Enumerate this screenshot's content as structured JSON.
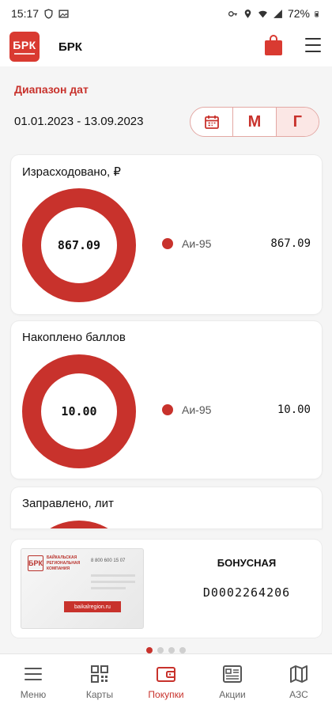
{
  "status_bar": {
    "time": "15:17",
    "battery": "72%"
  },
  "app_bar": {
    "logo_text": "БРК",
    "title": "БРК"
  },
  "date_range": {
    "label": "Диапазон дат",
    "value": "01.01.2023 - 13.09.2023",
    "segments": [
      {
        "label": "",
        "icon": "calendar-icon",
        "active": false
      },
      {
        "label": "М",
        "active": false
      },
      {
        "label": "Г",
        "active": true
      }
    ]
  },
  "cards": [
    {
      "title": "Израсходовано, ₽",
      "total": "867.09",
      "legend": [
        {
          "name": "Аи-95",
          "value": "867.09"
        }
      ]
    },
    {
      "title": "Накоплено баллов",
      "total": "10.00",
      "legend": [
        {
          "name": "Аи-95",
          "value": "10.00"
        }
      ]
    },
    {
      "title": "Заправлено, лит"
    }
  ],
  "bonus_card": {
    "title": "БОНУСНАЯ",
    "number": "D0002264206",
    "image": {
      "logo": "БРК",
      "company": "БАЙКАЛЬСКАЯ РЕГИОНАЛЬНАЯ КОМПАНИЯ",
      "phone": "8 800 600 15 07",
      "site": "baikalregion.ru"
    }
  },
  "pager": {
    "count": 4,
    "active_index": 0
  },
  "tabbar": [
    {
      "label": "Меню",
      "icon": "menu-icon"
    },
    {
      "label": "Карты",
      "icon": "qr-code-icon"
    },
    {
      "label": "Покупки",
      "icon": "wallet-icon",
      "active": true
    },
    {
      "label": "Акции",
      "icon": "promo-icon"
    },
    {
      "label": "АЗС",
      "icon": "map-icon"
    }
  ],
  "colors": {
    "accent": "#c8322c",
    "donut": "#c8322c",
    "background": "#f5f5f5"
  }
}
